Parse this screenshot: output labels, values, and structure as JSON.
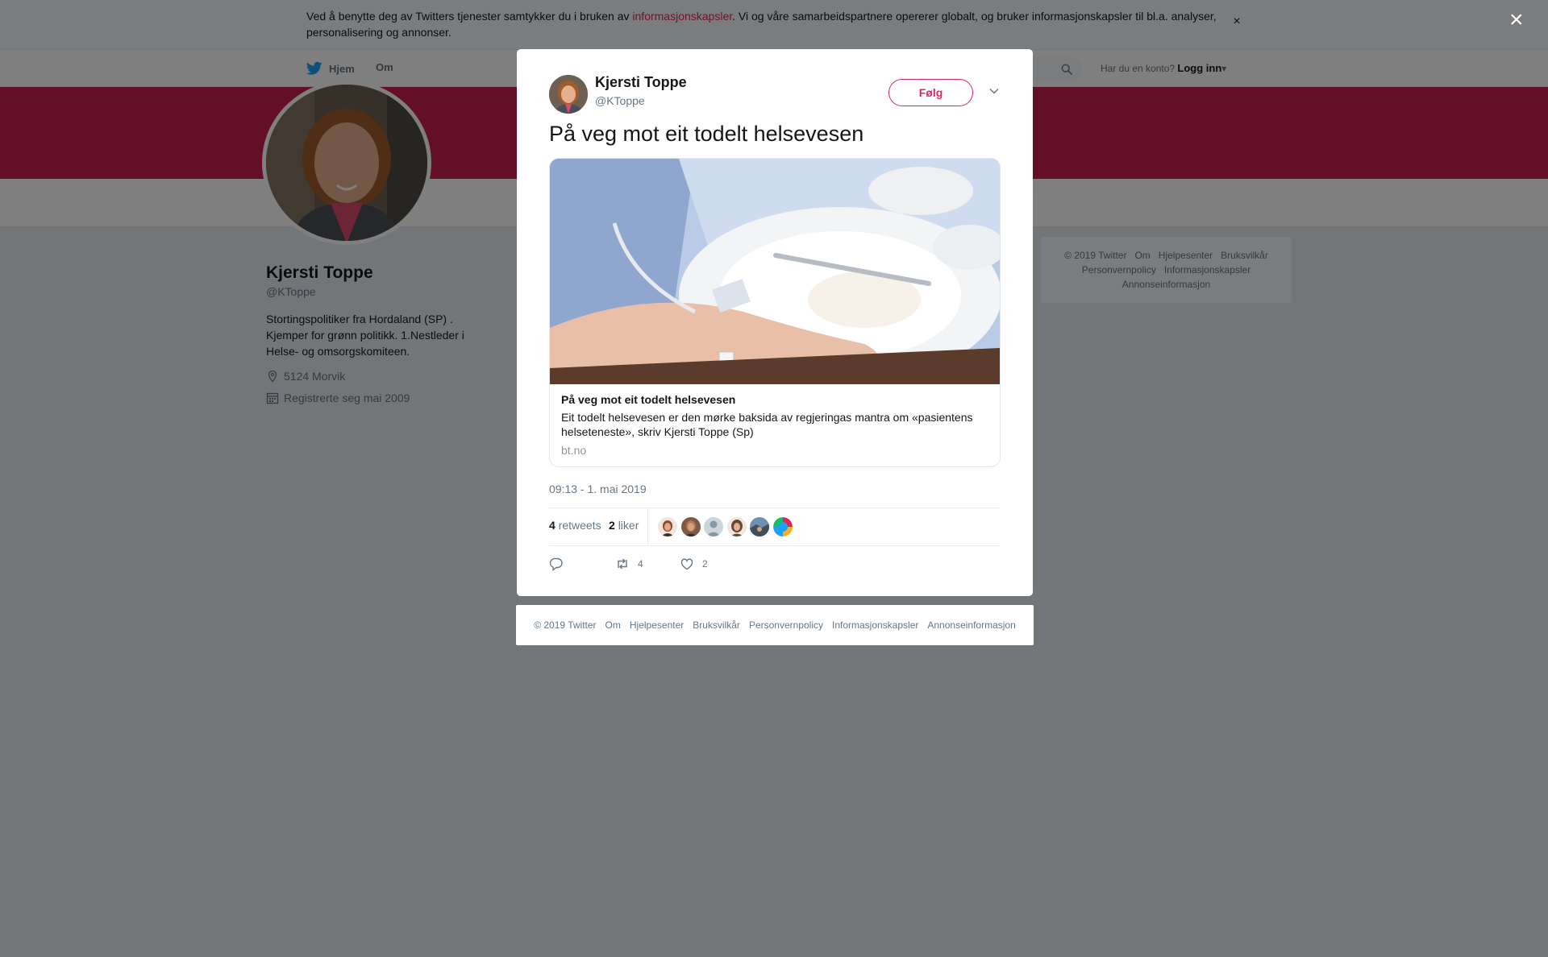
{
  "cookie": {
    "text_before": "Ved å benytte deg av Twitters tjenester samtykker du i bruken av ",
    "link": "informasjonskapsler",
    "text_after": ". Vi og våre samarbeidspartnere opererer globalt, og bruker informasjonskapsler til bl.a. analyser, personalisering og annonser.",
    "close": "×"
  },
  "nav": {
    "home": "Hjem",
    "about": "Om",
    "account_prompt": "Har du en konto?",
    "login": "Logg inn"
  },
  "profile": {
    "name": "Kjersti Toppe",
    "handle": "@KToppe",
    "bio": "Stortingspolitiker fra Hordaland (SP) . Kjemper for grønn politikk. 1.Nestleder i Helse- og omsorgskomiteen.",
    "location": "5124 Morvik",
    "joined": "Registrerte seg mai 2009",
    "banner_color": "#c71f51"
  },
  "side_footer": {
    "row1": [
      "© 2019 Twitter",
      "Om",
      "Hjelpesenter",
      "Bruksvilkår"
    ],
    "row2": [
      "Personvernpolicy",
      "Informasjonskapsler"
    ],
    "row3": [
      "Annonseinformasjon"
    ]
  },
  "overlay": {
    "close": "×"
  },
  "tweet": {
    "name": "Kjersti Toppe",
    "handle": "@KToppe",
    "follow": "Følg",
    "text": "På veg mot eit todelt helsevesen",
    "card": {
      "title": "På veg mot eit todelt helsevesen",
      "description": "Eit todelt helsevesen er den mørke baksida av regjeringas mantra om «pasientens helseteneste», skriv Kjersti Toppe (Sp)",
      "domain": "bt.no"
    },
    "timestamp": "09:13 - 1. mai 2019",
    "retweets": {
      "count": "4",
      "label": "retweets"
    },
    "likes": {
      "count": "2",
      "label": "liker"
    },
    "actions": {
      "retweet_count": "4",
      "like_count": "2"
    }
  },
  "modal_footer": [
    "© 2019 Twitter",
    "Om",
    "Hjelpesenter",
    "Bruksvilkår",
    "Personvernpolicy",
    "Informasjonskapsler",
    "Annonseinformasjon"
  ],
  "colors": {
    "accent": "#e0245e",
    "twitter_blue": "#1da1f2",
    "muted": "#657786"
  },
  "icons": [
    "twitter-bird-icon",
    "search-icon",
    "location-icon",
    "calendar-icon",
    "chevron-down-icon",
    "reply-icon",
    "retweet-icon",
    "heart-icon",
    "close-icon"
  ]
}
